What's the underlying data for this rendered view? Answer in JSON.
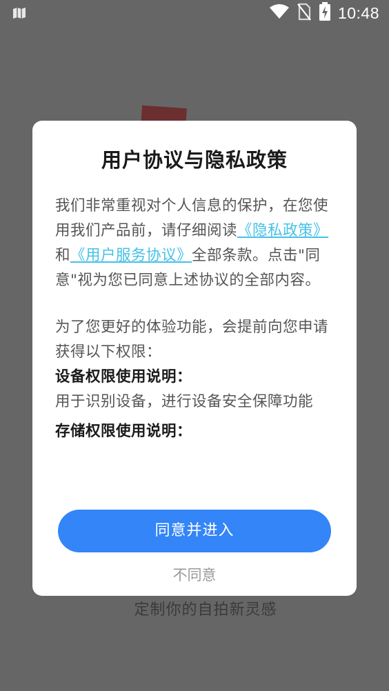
{
  "status_bar": {
    "time": "10:48",
    "icons": [
      "map-icon",
      "wifi-icon",
      "no-sim-icon",
      "battery-charging-icon"
    ]
  },
  "background": {
    "tagline": "定制你的自拍新灵感"
  },
  "dialog": {
    "title": "用户协议与隐私政策",
    "intro_prefix": "我们非常重视对个人信息的保护，在您使用我们产品前，请仔细阅读",
    "privacy_link": "《隐私政策》",
    "and_text": "和",
    "service_link": "《用户服务协议》",
    "intro_suffix": "全部条款。点击\"同意\"视为您已同意上述协议的全部内容。",
    "permission_intro": "为了您更好的体验功能，会提前向您申请获得以下权限：",
    "permissions": [
      {
        "heading": "设备权限使用说明：",
        "description": "用于识别设备，进行设备安全保障功能"
      },
      {
        "heading": "存储权限使用说明：",
        "description": ""
      }
    ],
    "agree_label": "同意并进入",
    "disagree_label": "不同意"
  },
  "colors": {
    "overlay": "#666666",
    "link": "#44c0e8",
    "primary_button": "#3385f8",
    "title_text": "#1a1a1a",
    "body_text": "#555555",
    "disagree_text": "#999999"
  }
}
